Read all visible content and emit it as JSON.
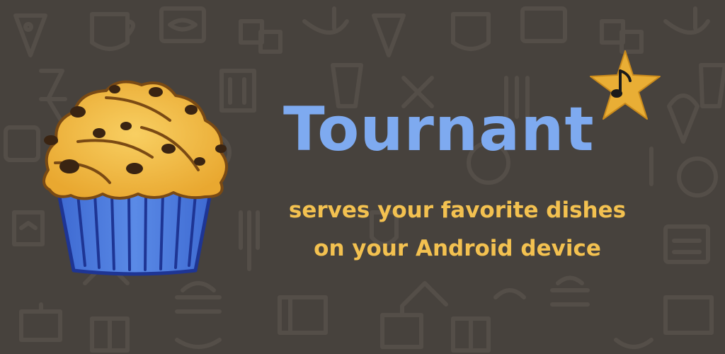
{
  "app": {
    "title": "Tournant",
    "tagline_line1": "serves your favorite dishes",
    "tagline_line2": "on your Android device"
  },
  "colors": {
    "background": "#47423d",
    "pattern": "#544e48",
    "title": "#7eaaf0",
    "tagline": "#f3c150",
    "muffin_top": "#f4b63c",
    "muffin_cup": "#4a78d8",
    "star": "#e9ae35"
  },
  "icons": [
    "background-food-pattern-icon",
    "muffin-logo-icon",
    "star-music-note-icon"
  ]
}
